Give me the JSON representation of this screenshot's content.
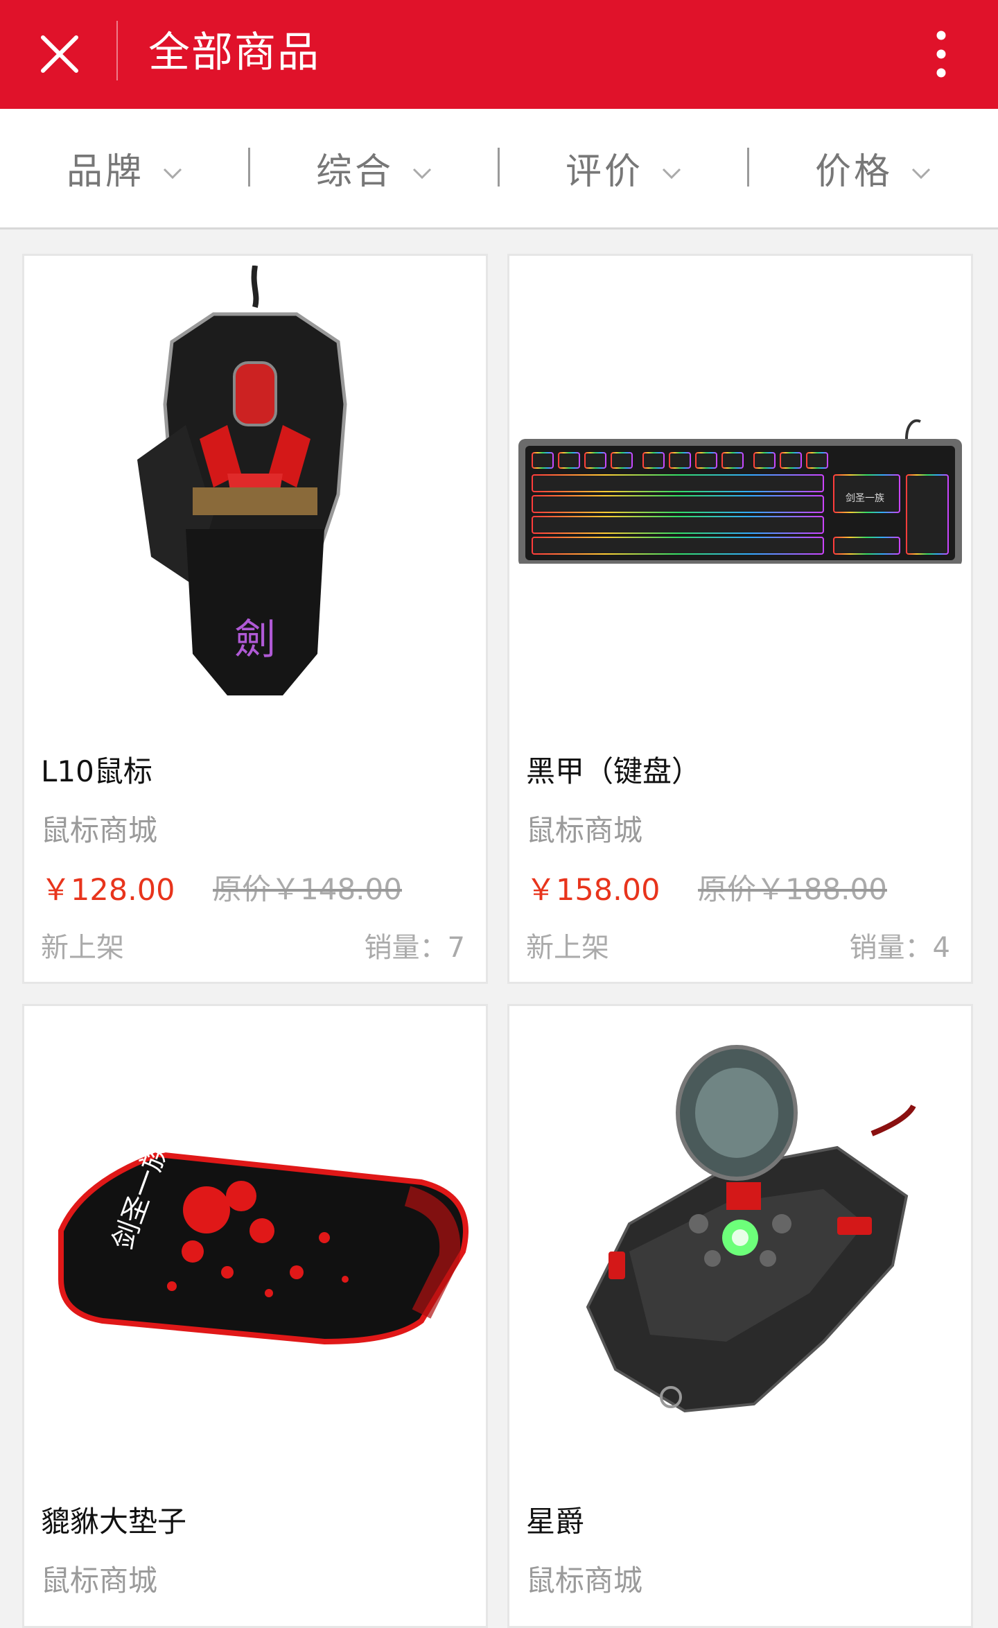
{
  "header": {
    "title": "全部商品",
    "close_icon": "close-icon",
    "more_icon": "more-vertical-icon",
    "bg_color": "#e0122a"
  },
  "filters": [
    {
      "label": "品牌"
    },
    {
      "label": "综合"
    },
    {
      "label": "评价"
    },
    {
      "label": "价格"
    }
  ],
  "products": [
    {
      "name": "L10鼠标",
      "shop": "鼠标商城",
      "price": "￥128.00",
      "original_price": "原价￥148.00",
      "tag": "新上架",
      "sales": "销量：7",
      "image": "gaming-mouse-image"
    },
    {
      "name": "黑甲（键盘）",
      "shop": "鼠标商城",
      "price": "￥158.00",
      "original_price": "原价￥188.00",
      "tag": "新上架",
      "sales": "销量：4",
      "image": "mechanical-keyboard-image"
    },
    {
      "name": "貔貅大垫子",
      "shop": "鼠标商城",
      "image": "mouse-pad-image"
    },
    {
      "name": "星爵",
      "shop": "鼠标商城",
      "image": "gaming-mouse-image"
    }
  ],
  "colors": {
    "accent": "#e0122a",
    "price": "#e8341c"
  }
}
